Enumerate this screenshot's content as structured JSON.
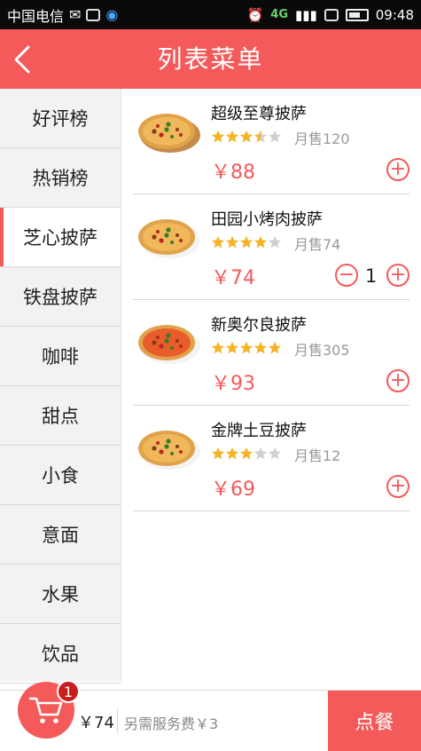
{
  "statusbar": {
    "carrier": "中国电信",
    "network": "4G",
    "time": "09:48"
  },
  "header": {
    "title": "列表菜单",
    "back_icon": "chevron-left-icon"
  },
  "sidebar": {
    "items": [
      {
        "label": "好评榜"
      },
      {
        "label": "热销榜"
      },
      {
        "label": "芝心披萨"
      },
      {
        "label": "铁盘披萨"
      },
      {
        "label": "咖啡"
      },
      {
        "label": "甜点"
      },
      {
        "label": "小食"
      },
      {
        "label": "意面"
      },
      {
        "label": "水果"
      },
      {
        "label": "饮品"
      }
    ],
    "active_index": 2
  },
  "products": [
    {
      "name": "超级至尊披萨",
      "rating": 3.5,
      "sold": "月售120",
      "price": "￥88",
      "quantity": null
    },
    {
      "name": "田园小烤肉披萨",
      "rating": 4,
      "sold": "月售74",
      "price": "￥74",
      "quantity": "1"
    },
    {
      "name": "新奥尔良披萨",
      "rating": 5,
      "sold": "月售305",
      "price": "￥93",
      "quantity": null
    },
    {
      "name": "金牌土豆披萨",
      "rating": 3,
      "sold": "月售12",
      "price": "￥69",
      "quantity": null
    }
  ],
  "bottom": {
    "cart_count": "1",
    "total": "￥74",
    "service_fee": "另需服务费￥3",
    "order_label": "点餐"
  },
  "colors": {
    "accent": "#f55a5a",
    "star_filled": "#f5b425",
    "star_empty": "#d0d0d0"
  }
}
